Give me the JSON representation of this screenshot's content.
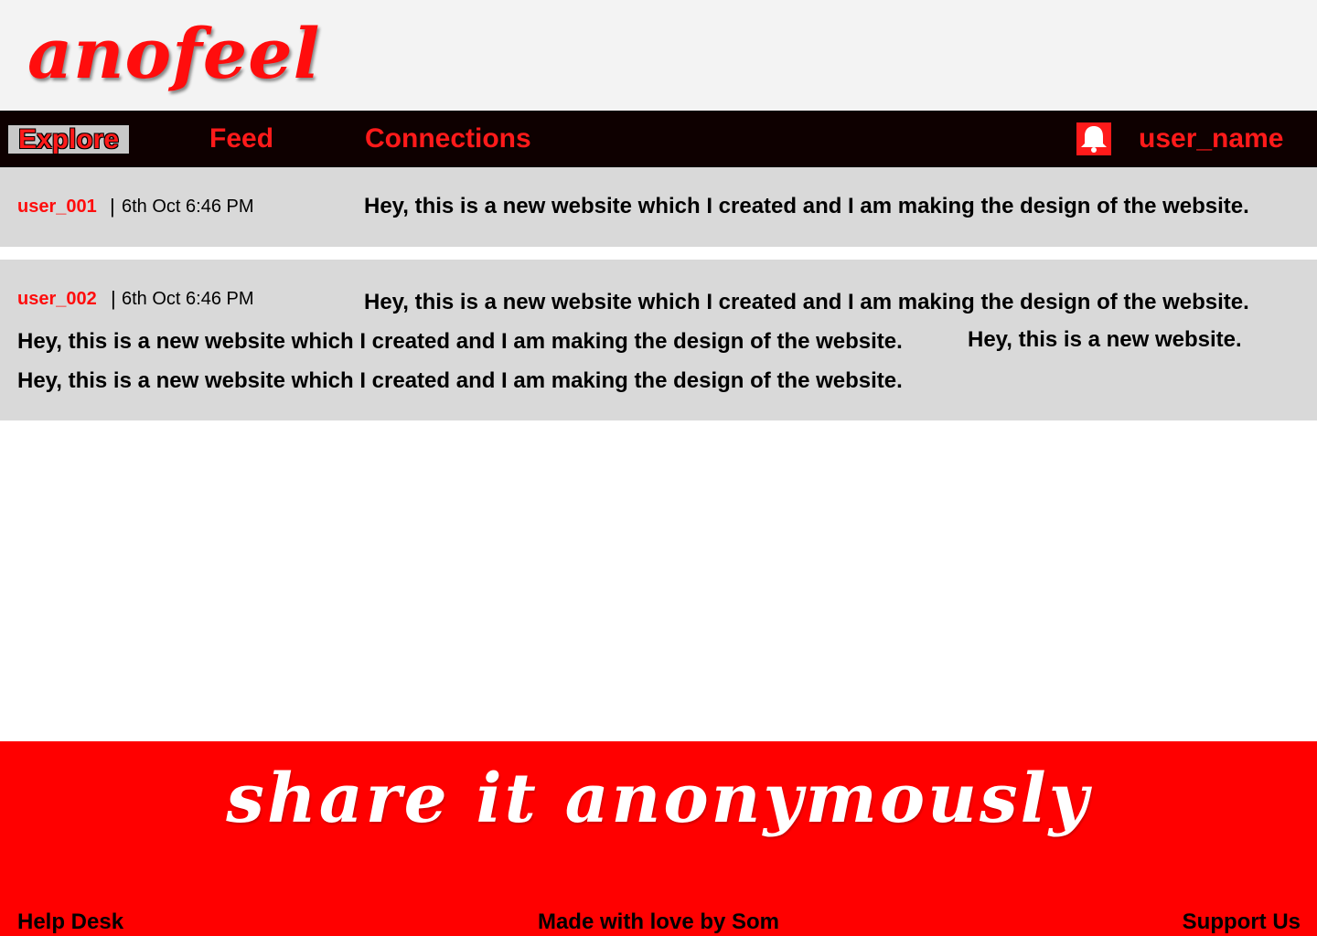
{
  "header": {
    "logo_text": "anofeel"
  },
  "nav": {
    "explore": "Explore",
    "feed": "Feed",
    "connections": "Connections",
    "notification_icon": "bell-icon",
    "username": "user_name"
  },
  "posts": [
    {
      "user": "user_001",
      "separator": "|",
      "time": "6th Oct 6:46 PM",
      "lines": [
        "Hey, this is a new website which I created and I am making the design of the website."
      ]
    },
    {
      "user": "user_002",
      "separator": "|",
      "time": "6th Oct 6:46 PM",
      "lines": [
        "Hey, this is a new website which I created and I am making the design of the website.",
        "Hey, this is a new website which I created and I am making the design of the website.",
        "Hey, this is a new website.",
        "Hey, this is a new website which I created and I am making the design of the website."
      ]
    }
  ],
  "footer": {
    "tagline": "share it anonymously",
    "help": "Help Desk",
    "made_by": "Made with love by Som",
    "support": "Support Us"
  },
  "colors": {
    "accent": "#ff0000",
    "nav_bg": "#0e0000",
    "post_bg": "#d9d9d9",
    "header_bg": "#f3f3f3"
  }
}
